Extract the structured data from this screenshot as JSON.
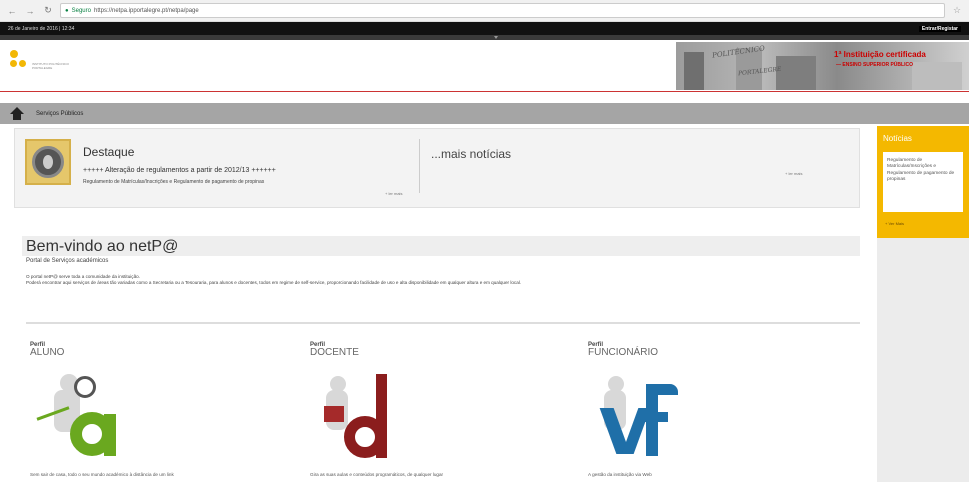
{
  "browser": {
    "back_icon": "arrow-left-icon",
    "forward_icon": "arrow-right-icon",
    "reload_icon": "reload-icon",
    "secure_label": "Seguro",
    "url": "https://netpa.ipportalegre.pt/netpa/page",
    "star_icon": "star-icon"
  },
  "topbar": {
    "date": "26 de Janeiro de 2016 | 12:34",
    "login": "Entrar/Registar"
  },
  "header": {
    "logo_text": "INSTITUTO POLITÉCNICO PORTALEGRE",
    "banner_cert": "1ª Instituição certificada",
    "banner_cert2": "— ENSINO SUPERIOR PÚBLICO",
    "banner_portal": "POLITÉCNICO",
    "banner_portal2": "PORTALEGRE"
  },
  "nav": {
    "home_icon": "home-icon",
    "crumb": "Serviços Públicos"
  },
  "feature": {
    "title": "Destaque",
    "line1": "+++++ Alteração de regulamentos a partir de 2012/13 ++++++",
    "line2": "Regulamento de Matrículas/Inscrições e Regulamento de pagamento de propinas",
    "more1": "+ ler mais",
    "more_title": "...mais notícias",
    "more2": "+ ler mais"
  },
  "welcome": {
    "title": "Bem-vindo ao netP@",
    "subtitle": "Portal de Serviços académicos",
    "p1": "O portal netP@ serve toda a comunidade da instituição.",
    "p2": "Poderá encontrar aqui serviços de áreas tão variadas como a Secretaria ou a Tesouraria, para alunos e docentes, todos em regime de self-service, proporcionando facilidade de uso e alta disponibilidade em qualquer altura e em qualquer local."
  },
  "profiles": [
    {
      "label": "Perfil",
      "name": "ALUNO",
      "desc": "Sem sair de casa, todo o seu mundo académico à distância de um link",
      "accent": "#6aa81f"
    },
    {
      "label": "Perfil",
      "name": "DOCENTE",
      "desc": "Gira as suas aulas e conteúdos programáticos, de qualquer lugar",
      "accent": "#8b1d1d"
    },
    {
      "label": "Perfil",
      "name": "FUNCIONÁRIO",
      "desc": "A gestão da instituição via Web",
      "accent": "#1f6fa8"
    }
  ],
  "sidebar": {
    "title": "Notícias",
    "item": "Regulamento de Matrículas/Inscrições e Regulamento de pagamento de propinas",
    "more": "+ Ver Mais"
  },
  "colors": {
    "accent_yellow": "#f4b800",
    "header_red": "#cc3333",
    "nav_grey": "#a5a5a5"
  }
}
